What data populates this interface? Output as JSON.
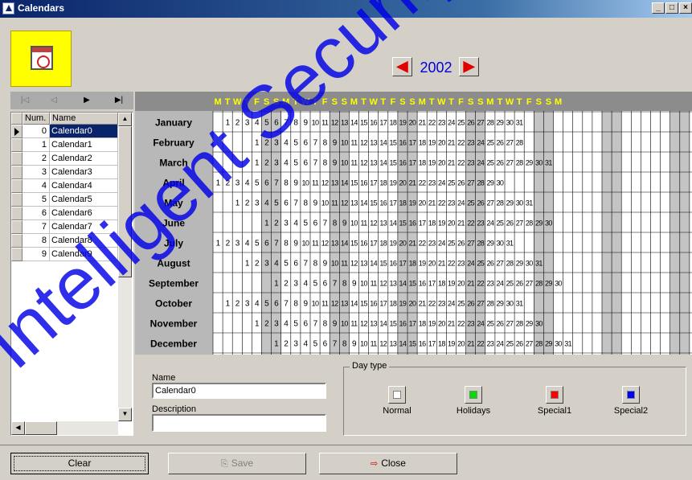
{
  "window": {
    "title": "Calendars",
    "controls": [
      "_",
      "□",
      "×"
    ]
  },
  "year_selector": {
    "year": "2002",
    "prev_icon": "left-arrow-icon",
    "next_icon": "right-arrow-icon"
  },
  "navigator": {
    "first": "|◁",
    "prev": "◁",
    "next": "▶",
    "last": "▶|"
  },
  "calendar_grid": {
    "columns": [
      "Num.",
      "Name"
    ],
    "rows": [
      {
        "num": "0",
        "name": "Calendar0",
        "selected": true
      },
      {
        "num": "1",
        "name": "Calendar1"
      },
      {
        "num": "2",
        "name": "Calendar2"
      },
      {
        "num": "3",
        "name": "Calendar3"
      },
      {
        "num": "4",
        "name": "Calendar4"
      },
      {
        "num": "5",
        "name": "Calendar5"
      },
      {
        "num": "6",
        "name": "Calendar6"
      },
      {
        "num": "7",
        "name": "Calendar7"
      },
      {
        "num": "8",
        "name": "Calendar8"
      },
      {
        "num": "9",
        "name": "Calendar9"
      }
    ]
  },
  "year_calendar": {
    "weekday_header": [
      "M",
      "T",
      "W",
      "T",
      "F",
      "S",
      "S",
      "M",
      "T",
      "W",
      "T",
      "F",
      "S",
      "S",
      "M",
      "T",
      "W",
      "T",
      "F",
      "S",
      "S",
      "M",
      "T",
      "W",
      "T",
      "F",
      "S",
      "S",
      "M",
      "T",
      "W",
      "T",
      "F",
      "S",
      "S",
      "M"
    ],
    "weekend_color": "#ffff00",
    "weekday_color": "#ffff00",
    "months": [
      {
        "name": "January",
        "offset": 1,
        "days": 31
      },
      {
        "name": "February",
        "offset": 4,
        "days": 28
      },
      {
        "name": "March",
        "offset": 4,
        "days": 31
      },
      {
        "name": "April",
        "offset": 0,
        "days": 30
      },
      {
        "name": "May",
        "offset": 2,
        "days": 31
      },
      {
        "name": "June",
        "offset": 5,
        "days": 30
      },
      {
        "name": "July",
        "offset": 0,
        "days": 31
      },
      {
        "name": "August",
        "offset": 3,
        "days": 31
      },
      {
        "name": "September",
        "offset": 6,
        "days": 30
      },
      {
        "name": "October",
        "offset": 1,
        "days": 31
      },
      {
        "name": "November",
        "offset": 4,
        "days": 30
      },
      {
        "name": "December",
        "offset": 6,
        "days": 31
      }
    ]
  },
  "form": {
    "name_label": "Name",
    "name_value": "Calendar0",
    "description_label": "Description",
    "description_value": ""
  },
  "day_type": {
    "legend": "Day type",
    "items": [
      {
        "label": "Normal",
        "color": "#ffffff"
      },
      {
        "label": "Holidays",
        "color": "#00e000"
      },
      {
        "label": "Special1",
        "color": "#ff0000"
      },
      {
        "label": "Special2",
        "color": "#0000ff"
      }
    ]
  },
  "buttons": {
    "clear": "Clear",
    "save": "Save",
    "close": "Close"
  },
  "watermark": "Intelligent Security"
}
